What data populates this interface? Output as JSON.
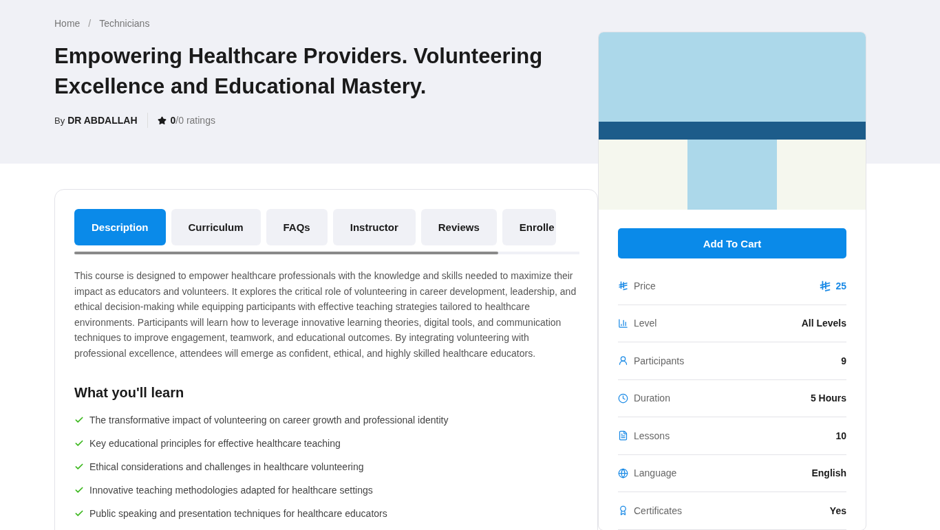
{
  "breadcrumb": [
    {
      "label": "Home"
    },
    {
      "label": "Technicians"
    }
  ],
  "breadcrumb_separator": "/",
  "course": {
    "title": "Empowering Healthcare Providers. Volunteering Excellence and Educational Mastery.",
    "by_label": "By",
    "author": "DR ABDALLAH",
    "rating": "0",
    "rating_count": "/0 ratings"
  },
  "tabs": [
    {
      "label": "Description",
      "selected": true
    },
    {
      "label": "Curriculum",
      "selected": false
    },
    {
      "label": "FAQs",
      "selected": false
    },
    {
      "label": "Instructor",
      "selected": false
    },
    {
      "label": "Reviews",
      "selected": false
    },
    {
      "label": "Enrolle",
      "selected": false
    }
  ],
  "description": "This course is designed to empower healthcare professionals with the knowledge and skills needed to maximize their impact as educators and volunteers. It explores the critical role of volunteering in career development, leadership, and ethical decision-making while equipping participants with effective teaching strategies tailored to healthcare environments. Participants will learn how to leverage innovative learning theories, digital tools, and communication techniques to improve engagement, teamwork, and educational outcomes. By integrating volunteering with professional excellence, attendees will emerge as confident, ethical, and highly skilled healthcare educators.",
  "learn": {
    "heading": "What you'll learn",
    "items": [
      "The transformative impact of volunteering on career growth and professional identity",
      "Key educational principles for effective healthcare teaching",
      "Ethical considerations and challenges in healthcare volunteering",
      "Innovative teaching methodologies adapted for healthcare settings",
      "Public speaking and presentation techniques for healthcare educators"
    ]
  },
  "sidebar": {
    "button": "Add To Cart",
    "details": [
      {
        "kind": "price",
        "label": "Price",
        "value": "25"
      },
      {
        "kind": "text",
        "label": "Level",
        "value": "All Levels"
      },
      {
        "kind": "text",
        "label": "Participants",
        "value": "9"
      },
      {
        "kind": "text",
        "label": "Duration",
        "value": "5 Hours"
      },
      {
        "kind": "text",
        "label": "Lessons",
        "value": "10"
      },
      {
        "kind": "text",
        "label": "Language",
        "value": "English"
      },
      {
        "kind": "text",
        "label": "Certificates",
        "value": "Yes"
      }
    ]
  }
}
